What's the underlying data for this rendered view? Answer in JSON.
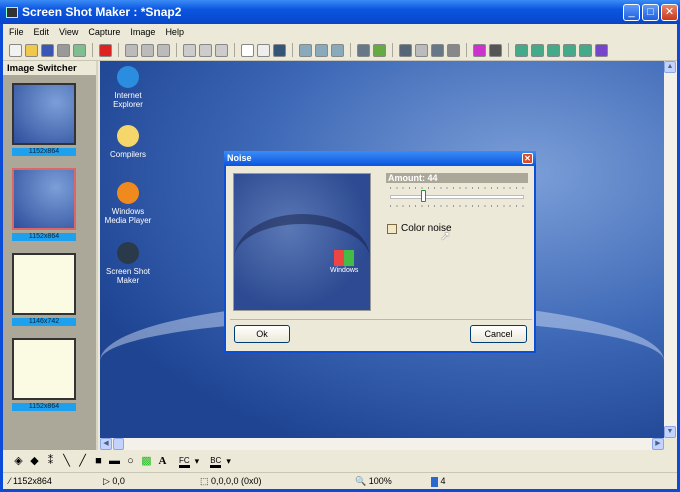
{
  "window": {
    "title": "Screen Shot Maker : *Snap2"
  },
  "menu": [
    "File",
    "Edit",
    "View",
    "Capture",
    "Image",
    "Help"
  ],
  "toolbar_icons": [
    {
      "name": "new-icon",
      "color": "#f2f2f2"
    },
    {
      "name": "open-icon",
      "color": "#f0c84a"
    },
    {
      "name": "save-icon",
      "color": "#3a55b5"
    },
    {
      "name": "print-icon",
      "color": "#999"
    },
    {
      "name": "recycle-icon",
      "color": "#7fbf8f"
    },
    "sep",
    {
      "name": "flag-icon",
      "color": "#d22"
    },
    "sep",
    {
      "name": "capture-icon",
      "color": "#bbb"
    },
    {
      "name": "undo-icon",
      "color": "#bbb"
    },
    {
      "name": "redo-icon",
      "color": "#bbb"
    },
    "sep",
    {
      "name": "copy-icon",
      "color": "#ccc"
    },
    {
      "name": "paste-icon",
      "color": "#ccc"
    },
    {
      "name": "paste-new-icon",
      "color": "#ccc"
    },
    "sep",
    {
      "name": "hand-icon",
      "color": "#fff"
    },
    {
      "name": "select-rect-icon",
      "color": "#eee"
    },
    {
      "name": "pipette-icon",
      "color": "#357"
    },
    "sep",
    {
      "name": "zoom-in-icon",
      "color": "#8ab"
    },
    {
      "name": "zoom-icon",
      "color": "#8ab"
    },
    {
      "name": "zoom-out-icon",
      "color": "#8ab"
    },
    "sep",
    {
      "name": "list-icon",
      "color": "#678"
    },
    {
      "name": "effects-icon",
      "color": "#6a4"
    },
    "sep",
    {
      "name": "crop-icon",
      "color": "#567"
    },
    {
      "name": "grid-icon",
      "color": "#bbb"
    },
    {
      "name": "rotate-icon",
      "color": "#678"
    },
    {
      "name": "resize-icon",
      "color": "#888"
    },
    "sep",
    {
      "name": "color-icon",
      "color": "#c3c"
    },
    {
      "name": "function-icon",
      "color": "#555"
    },
    "sep",
    {
      "name": "window-capture-icon",
      "color": "#4a8"
    },
    {
      "name": "region-capture-icon",
      "color": "#4a8"
    },
    {
      "name": "screen-capture-icon",
      "color": "#4a8"
    },
    {
      "name": "object-capture-icon",
      "color": "#4a8"
    },
    {
      "name": "scroll-capture-icon",
      "color": "#4a8"
    },
    {
      "name": "go-icon",
      "color": "#74c"
    }
  ],
  "sidebar": {
    "title": "Image Switcher",
    "thumbs": [
      {
        "label": "1152x864",
        "kind": "desktop",
        "selected": false
      },
      {
        "label": "1152x864",
        "kind": "desktop",
        "selected": true
      },
      {
        "label": "1146x742",
        "kind": "document",
        "selected": false
      },
      {
        "label": "1152x864",
        "kind": "document",
        "selected": false
      }
    ]
  },
  "desktop_icons": [
    {
      "label": "Internet Explorer",
      "color": "#2a8de0"
    },
    {
      "label": "Compilers",
      "color": "#f5d66a"
    },
    {
      "label": "Windows Media Player",
      "color": "#f08a1e"
    },
    {
      "label": "Screen Shot Maker",
      "color": "#2a3a4a"
    }
  ],
  "dialog": {
    "title": "Noise",
    "amount_label": "Amount: 44",
    "amount": 44,
    "amount_max": 100,
    "color_noise_label": "Color noise",
    "color_noise": false,
    "ok": "Ok",
    "cancel": "Cancel",
    "preview_logo": "Windows"
  },
  "draw_tools": [
    "fill-icon",
    "brush-icon",
    "spray-icon",
    "line-icon",
    "pen-icon",
    "rectangle-icon",
    "rounded-rect-icon",
    "ellipse-icon",
    "shadow-icon",
    "text-icon"
  ],
  "text_tool": "A",
  "fc_label": "FC",
  "bc_label": "BC",
  "status": {
    "size": "1152x864",
    "cursor": "0,0",
    "selection": "0,0,0,0 (0x0)",
    "zoom": "100%",
    "count": "4"
  }
}
